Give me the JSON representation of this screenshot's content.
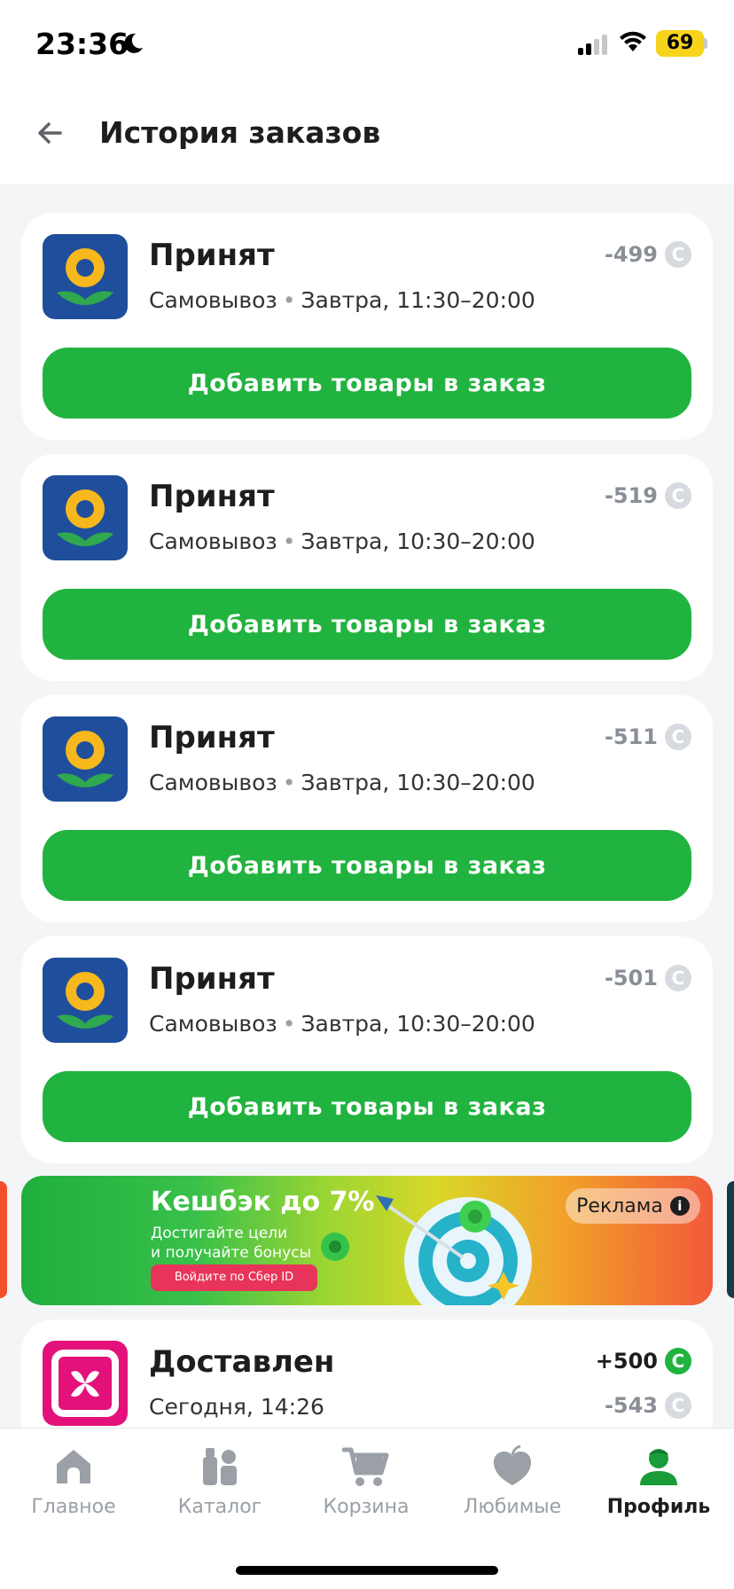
{
  "status_bar": {
    "time": "23:36",
    "battery": "69"
  },
  "header": {
    "title": "История заказов"
  },
  "orders": [
    {
      "status": "Принят",
      "delivery": "Самовывоз",
      "time": "Завтра, 11:30–20:00",
      "bonus": "-499",
      "button": "Добавить товары в заказ"
    },
    {
      "status": "Принят",
      "delivery": "Самовывоз",
      "time": "Завтра, 10:30–20:00",
      "bonus": "-519",
      "button": "Добавить товары в заказ"
    },
    {
      "status": "Принят",
      "delivery": "Самовывоз",
      "time": "Завтра, 10:30–20:00",
      "bonus": "-511",
      "button": "Добавить товары в заказ"
    },
    {
      "status": "Принят",
      "delivery": "Самовывоз",
      "time": "Завтра, 10:30–20:00",
      "bonus": "-501",
      "button": "Добавить товары в заказ"
    }
  ],
  "banner": {
    "title": "Кешбэк до 7%",
    "text_line1": "Достигайте цели",
    "text_line2": "и получайте бонусы",
    "button": "Войдите по Сбер ID",
    "ad_label": "Реклама"
  },
  "delivered_order": {
    "status": "Доставлен",
    "time": "Сегодня, 14:26",
    "bonus_plus": "+500",
    "bonus_minus": "-543"
  },
  "tabbar": {
    "items": [
      {
        "label": "Главное",
        "icon": "home-icon"
      },
      {
        "label": "Каталог",
        "icon": "catalog-icon"
      },
      {
        "label": "Корзина",
        "icon": "cart-icon"
      },
      {
        "label": "Любимые",
        "icon": "heart-apple-icon"
      },
      {
        "label": "Профиль",
        "icon": "profile-icon",
        "active": true
      }
    ]
  },
  "colors": {
    "accent": "#21b33f",
    "logo_blue": "#1f4e9c",
    "logo_yellow": "#f6b81c",
    "logo_pink": "#e3127a"
  }
}
